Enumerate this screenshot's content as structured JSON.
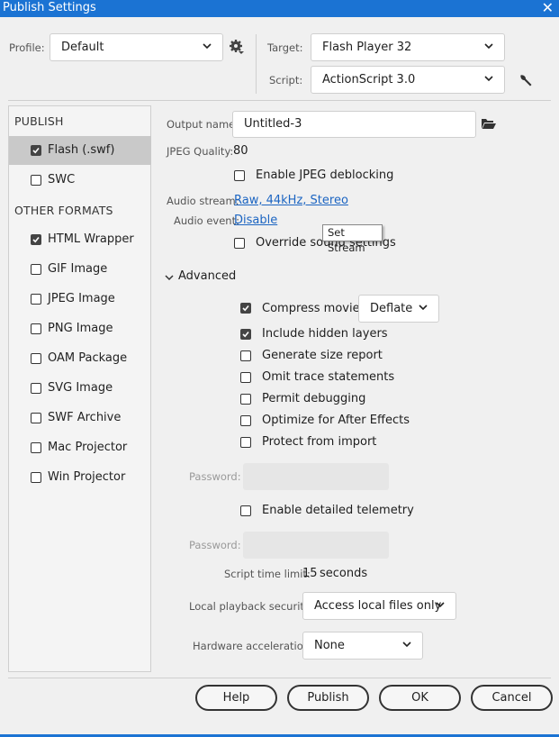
{
  "window": {
    "title": "Publish Settings",
    "close_glyph": "✕"
  },
  "profile": {
    "label": "Profile:",
    "value": "Default",
    "settings_icon": "gear-icon"
  },
  "target": {
    "label": "Target:",
    "value": "Flash Player 32"
  },
  "script": {
    "label": "Script:",
    "value": "ActionScript 3.0",
    "settings_icon": "wrench-icon"
  },
  "left_panel": {
    "publish_header": "PUBLISH",
    "publish_items": [
      {
        "label": "Flash (.swf)",
        "checked": true,
        "selected": true
      },
      {
        "label": "SWC",
        "checked": false,
        "selected": false
      }
    ],
    "other_header": "OTHER FORMATS",
    "other_items": [
      {
        "label": "HTML Wrapper",
        "checked": true
      },
      {
        "label": "GIF Image",
        "checked": false
      },
      {
        "label": "JPEG Image",
        "checked": false
      },
      {
        "label": "PNG Image",
        "checked": false
      },
      {
        "label": "OAM Package",
        "checked": false
      },
      {
        "label": "SVG Image",
        "checked": false
      },
      {
        "label": "SWF Archive",
        "checked": false
      },
      {
        "label": "Mac Projector",
        "checked": false
      },
      {
        "label": "Win Projector",
        "checked": false
      }
    ]
  },
  "settings": {
    "output_name_label": "Output name:",
    "output_name_value": "Untitled-3",
    "folder_icon": "folder-icon",
    "jpeg_quality_label": "JPEG Quality:",
    "jpeg_quality_value": "80",
    "enable_jpeg_deblocking": {
      "label": "Enable JPEG deblocking",
      "checked": false
    },
    "audio_stream_label": "Audio stream:",
    "audio_stream_value": "Raw, 44kHz, Stereo",
    "audio_event_label": "Audio event:",
    "audio_event_value": "Disable",
    "override_sound": {
      "label": "Override sound settings",
      "checked": false
    },
    "tooltip": "Set Stream"
  },
  "advanced": {
    "header": "Advanced",
    "compress_movie": {
      "label": "Compress movie",
      "checked": true
    },
    "compression_value": "Deflate",
    "options": [
      {
        "label": "Include hidden layers",
        "checked": true
      },
      {
        "label": "Generate size report",
        "checked": false
      },
      {
        "label": "Omit trace statements",
        "checked": false
      },
      {
        "label": "Permit debugging",
        "checked": false
      },
      {
        "label": "Optimize for After Effects",
        "checked": false
      },
      {
        "label": "Protect from import",
        "checked": false
      }
    ],
    "password_label": "Password:",
    "enable_telemetry": {
      "label": "Enable detailed telemetry",
      "checked": false
    },
    "password2_label": "Password:",
    "script_time_limit_label": "Script time limit:",
    "script_time_limit_value": "15",
    "script_time_limit_unit": "seconds",
    "local_playback_label": "Local playback security:",
    "local_playback_value": "Access local files only",
    "hardware_accel_label": "Hardware acceleration:",
    "hardware_accel_value": "None"
  },
  "buttons": {
    "help": "Help",
    "publish": "Publish",
    "ok": "OK",
    "cancel": "Cancel"
  },
  "colors": {
    "title_bar": "#1b73d3",
    "link": "#1c65c2",
    "selected_row": "#c9c9c9"
  }
}
